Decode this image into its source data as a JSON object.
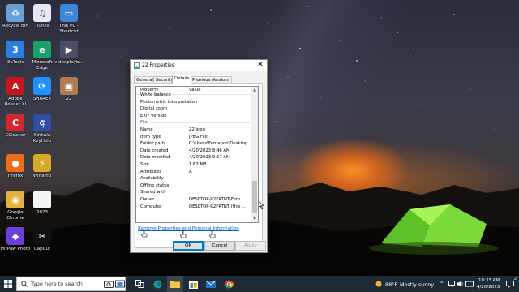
{
  "desktop": {
    "icons": [
      {
        "name": "recycle-bin",
        "label": "Recycle Bin",
        "icon": "recycle-bin-icon",
        "color": "#6aa0d8",
        "glyph": "♻"
      },
      {
        "name": "itunes",
        "label": "iTunes",
        "icon": "itunes-icon",
        "color": "#e8e8f4",
        "glyph": "♫"
      },
      {
        "name": "this-pc",
        "label": "This PC - Shortcut",
        "icon": "monitor-icon",
        "color": "#3f86d8",
        "glyph": "▭"
      },
      {
        "name": "3utools",
        "label": "3uTools",
        "icon": "3utools-icon",
        "color": "#2a7de1",
        "glyph": "3"
      },
      {
        "name": "edge",
        "label": "Microsoft Edge",
        "icon": "edge-icon",
        "color": "#1aa06d",
        "glyph": "e"
      },
      {
        "name": "videoplayback",
        "label": "videoplayb...",
        "icon": "video-file-icon",
        "color": "#4a4f66",
        "glyph": "▶"
      },
      {
        "name": "adobe-reader",
        "label": "Adobe Reader XI",
        "icon": "adobe-reader-icon",
        "color": "#c8161d",
        "glyph": "A"
      },
      {
        "name": "shareit",
        "label": "SHAREit",
        "icon": "shareit-icon",
        "color": "#1e90ff",
        "glyph": "⟳"
      },
      {
        "name": "image-22",
        "label": "22",
        "icon": "image-thumbnail-icon",
        "color": "#b07c52",
        "glyph": "▣"
      },
      {
        "name": "ccleaner",
        "label": "CCleaner",
        "icon": "ccleaner-icon",
        "color": "#d8262e",
        "glyph": "C"
      },
      {
        "name": "sinhala-keyhelp",
        "label": "Sinhala KeyHelp",
        "icon": "sinhala-keyhelp-icon",
        "color": "#2e4fa3",
        "glyph": "අ"
      },
      {
        "name": "firefox",
        "label": "Firefox",
        "icon": "firefox-icon",
        "color": "#f26b1d",
        "glyph": "●"
      },
      {
        "name": "winamp",
        "label": "Winamp",
        "icon": "winamp-icon",
        "color": "#d7a928",
        "glyph": "⚡"
      },
      {
        "name": "chrome",
        "label": "Google Chrome",
        "icon": "chrome-icon",
        "color": "#e3b341",
        "glyph": "◉"
      },
      {
        "name": "file-2023",
        "label": "2023",
        "icon": "document-icon",
        "color": "#f4f4f4",
        "glyph": ""
      },
      {
        "name": "hitpaw",
        "label": "HitPaw Photo ...",
        "icon": "hitpaw-icon",
        "color": "#6b3fd8",
        "glyph": "◆"
      },
      {
        "name": "capcut",
        "label": "CapCut",
        "icon": "capcut-icon",
        "color": "#111111",
        "glyph": "✂"
      }
    ]
  },
  "dialog": {
    "title": "22 Properties",
    "close_label": "✕",
    "tabs": [
      "General",
      "Security",
      "Details",
      "Previous Versions"
    ],
    "active_tab": "Details",
    "columns": {
      "property": "Property",
      "value": "Value"
    },
    "rows": [
      {
        "p": "White balance",
        "v": ""
      },
      {
        "p": "Photometric interpretation",
        "v": ""
      },
      {
        "p": "Digital zoom",
        "v": ""
      },
      {
        "p": "EXIF version",
        "v": ""
      },
      {
        "p": "File",
        "v": "",
        "section": true
      },
      {
        "p": "Name",
        "v": "22.jpeg"
      },
      {
        "p": "Item type",
        "v": "JPEG File"
      },
      {
        "p": "Folder path",
        "v": "C:\\Users\\Fernando\\Desktop"
      },
      {
        "p": "Date created",
        "v": "4/20/2023 8:46 AM"
      },
      {
        "p": "Date modified",
        "v": "4/20/2023 9:57 AM"
      },
      {
        "p": "Size",
        "v": "1.62 MB"
      },
      {
        "p": "Attributes",
        "v": "A"
      },
      {
        "p": "Availability",
        "v": ""
      },
      {
        "p": "Offline status",
        "v": ""
      },
      {
        "p": "Shared with",
        "v": ""
      },
      {
        "p": "Owner",
        "v": "DESKTOP-R2FRTNT\\Fern..."
      },
      {
        "p": "Computer",
        "v": "DESKTOP-R2FRTNT (this ..."
      }
    ],
    "remove_link": "Remove Properties and Personal Information",
    "buttons": {
      "ok": "OK",
      "cancel": "Cancel",
      "apply": "Apply"
    }
  },
  "taskbar": {
    "search_placeholder": "Type here to search",
    "weather_temp": "88°F",
    "weather_text": "Mostly sunny",
    "time": "10:33 AM",
    "date": "4/20/2023",
    "notification_count": "2"
  }
}
